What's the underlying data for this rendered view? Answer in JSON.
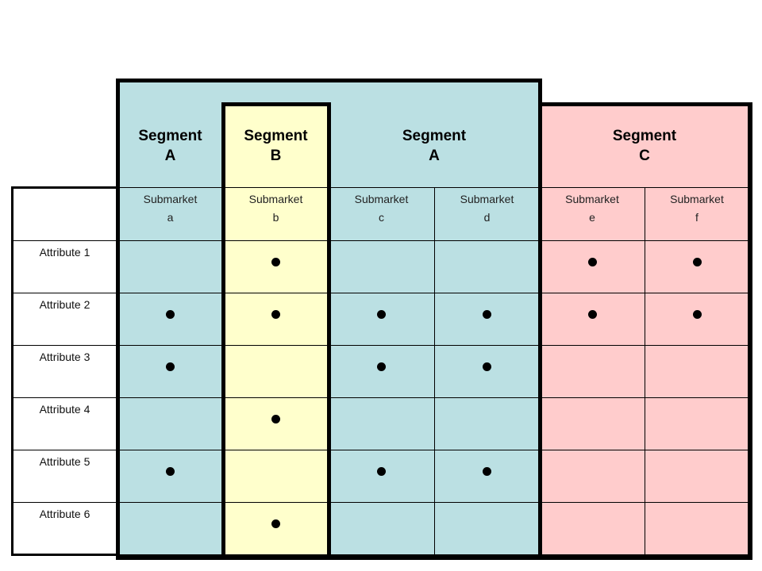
{
  "segments": [
    {
      "key": "A1",
      "title": "Segment",
      "letter": "A",
      "color": "#bbe0e3"
    },
    {
      "key": "B",
      "title": "Segment",
      "letter": "B",
      "color": "#ffffcc"
    },
    {
      "key": "A2",
      "title": "Segment",
      "letter": "A",
      "color": "#bbe0e3"
    },
    {
      "key": "C",
      "title": "Segment",
      "letter": "C",
      "color": "#ffcccc"
    }
  ],
  "submarkets": [
    {
      "label": "Submarket",
      "letter": "a",
      "segment": "A1"
    },
    {
      "label": "Submarket",
      "letter": "b",
      "segment": "B"
    },
    {
      "label": "Submarket",
      "letter": "c",
      "segment": "A2"
    },
    {
      "label": "Submarket",
      "letter": "d",
      "segment": "A2"
    },
    {
      "label": "Submarket",
      "letter": "e",
      "segment": "C"
    },
    {
      "label": "Submarket",
      "letter": "f",
      "segment": "C"
    }
  ],
  "attributes": [
    {
      "label": "Attribute 1",
      "marks": [
        false,
        true,
        false,
        false,
        true,
        true
      ]
    },
    {
      "label": "Attribute 2",
      "marks": [
        true,
        true,
        true,
        true,
        true,
        true
      ]
    },
    {
      "label": "Attribute 3",
      "marks": [
        true,
        false,
        true,
        true,
        false,
        false
      ]
    },
    {
      "label": "Attribute 4",
      "marks": [
        false,
        true,
        false,
        false,
        false,
        false
      ]
    },
    {
      "label": "Attribute 5",
      "marks": [
        true,
        false,
        true,
        true,
        false,
        false
      ]
    },
    {
      "label": "Attribute 6",
      "marks": [
        false,
        true,
        false,
        false,
        false,
        false
      ]
    }
  ],
  "mark_symbol": "filled-dot"
}
